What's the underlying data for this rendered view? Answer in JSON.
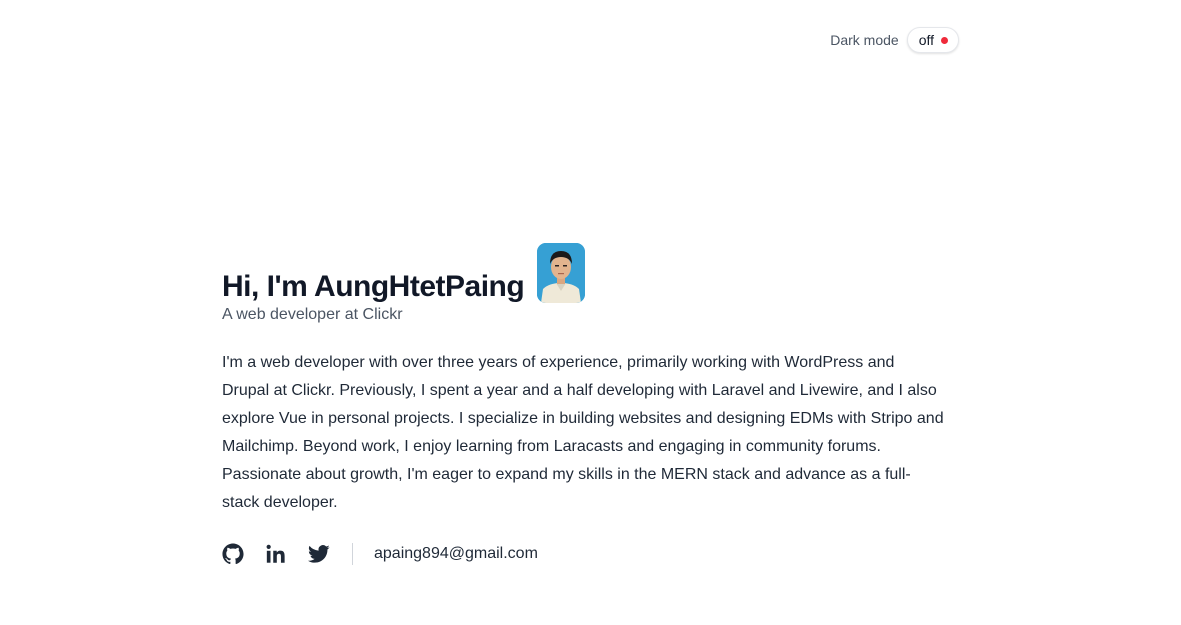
{
  "header": {
    "dark_mode_label": "Dark mode",
    "toggle_state": "off",
    "toggle_indicator_color": "#ef2a3a"
  },
  "hero": {
    "title": "Hi, I'm AungHtetPaing",
    "subtitle": "A web developer at Clickr",
    "avatar_alt": "profile photo"
  },
  "bio": "I'm a web developer with over three years of experience, primarily working with WordPress and Drupal at Clickr. Previously, I spent a year and a half developing with Laravel and Livewire, and I also explore Vue in personal projects. I specialize in building websites and designing EDMs with Stripo and Mailchimp. Beyond work, I enjoy learning from Laracasts and engaging in community forums. Passionate about growth, I'm eager to expand my skills in the MERN stack and advance as a full-stack developer.",
  "social": {
    "icons": [
      "github-icon",
      "linkedin-icon",
      "twitter-icon"
    ],
    "email": "apaing894@gmail.com"
  },
  "colors": {
    "text": "#111827",
    "muted": "#4b5563",
    "icon": "#1f2937"
  }
}
